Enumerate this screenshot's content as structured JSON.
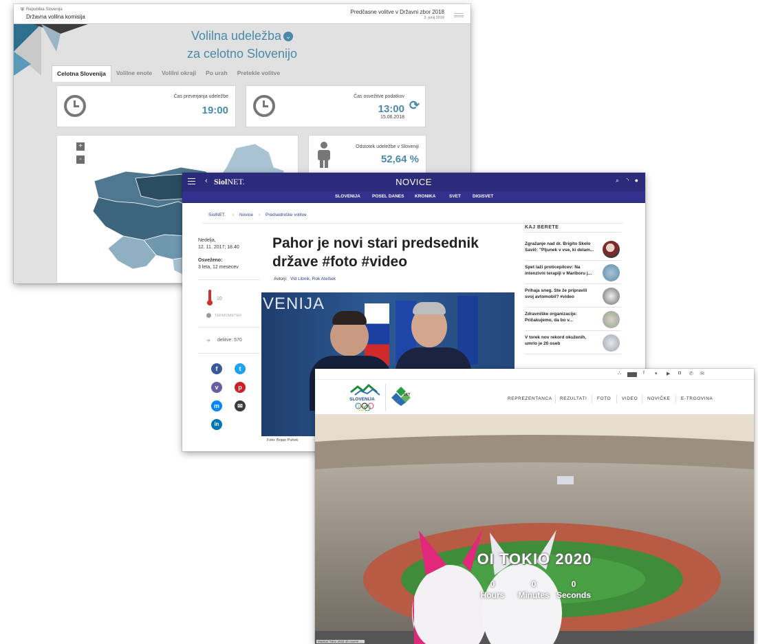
{
  "dvk": {
    "header": {
      "org_small": "Republika Slovenija",
      "org_name": "Državna volilna komisija",
      "election": "Predčasne volitve v Državni zbor 2018",
      "election_date": "3. junij 2018"
    },
    "title_line1": "Volilna udeležba",
    "title_line2": "za celotno Slovenijo",
    "tabs": [
      "Celotna Slovenija",
      "Volilne enote",
      "Volilni okraji",
      "Po urah",
      "Pretekle volitve"
    ],
    "check_time": {
      "label": "Čas preverjanja udeležbe",
      "value": "19:00"
    },
    "refresh_time": {
      "label": "Čas osvežitve podatkov",
      "value": "13:00",
      "date": "15.06.2018"
    },
    "turnout": {
      "label": "Odstotek udeležbe v Sloveniji",
      "value": "52,64 %"
    },
    "map_controls": {
      "zoom_in": "+",
      "zoom_out": "-"
    },
    "colors": {
      "accent": "#4a8aa9"
    }
  },
  "siol": {
    "logo_bold": "Siol",
    "logo_light": "NET.",
    "section_title": "NOVICE",
    "nav": [
      "SLOVENIJA",
      "POSEL DANES",
      "KRONIKA",
      "SVET",
      "DIGISVET"
    ],
    "breadcrumb": [
      "SiolNET.",
      "Novice",
      "Predsedniške volitve"
    ],
    "date_line1": "Nedelja,",
    "date_line2": "12. 11. 2017; 18.40",
    "updated_label": "Osveženo:",
    "updated_value": "3 leta, 12 mesecev",
    "thermo_value": "10",
    "thermo_label": "TERMOMETER",
    "shares": "delitve: 570",
    "headline": "Pahor je novi stari predsednik države #foto #video",
    "authors_label": "Avtorji:",
    "authors": "Vid Libnik, Rok Atelšek",
    "photo_text": "VENIJA",
    "photo_credit": "Foto: Bojan Puhek",
    "side_heading": "KAJ BERETE",
    "side_items": [
      "Zgražanje nad dr. Brigito Skelo Savič: \"Pljunek v vse, ki delam...",
      "Spet laži proticepilcev: Na intenzivni terapiji v Mariboru j...",
      "Prihaja sneg. Ste že pripravili svoj avtomobil? #video",
      "Zdravniške organizacije: Pričakujemo, da bo v...",
      "V torek nov rekord okuženih, umrlo je 20 oseb"
    ],
    "colors": {
      "brand": "#2c2a7a"
    }
  },
  "oks": {
    "logo_text": "SLOVENIJA",
    "anniv_text": "LET",
    "menu": [
      "REPREZENTANCA",
      "REZULTATI",
      "FOTO",
      "VIDEO",
      "NOVIČKE",
      "E-TRGOVINA"
    ],
    "headline": "OI TOKIO 2020",
    "countdown": [
      {
        "value": "0",
        "unit": "Hours"
      },
      {
        "value": "0",
        "unit": "Minutes"
      },
      {
        "value": "0",
        "unit": "Seconds"
      }
    ],
    "caption": "Maskoti Tokio 2020 ob novem ...."
  }
}
